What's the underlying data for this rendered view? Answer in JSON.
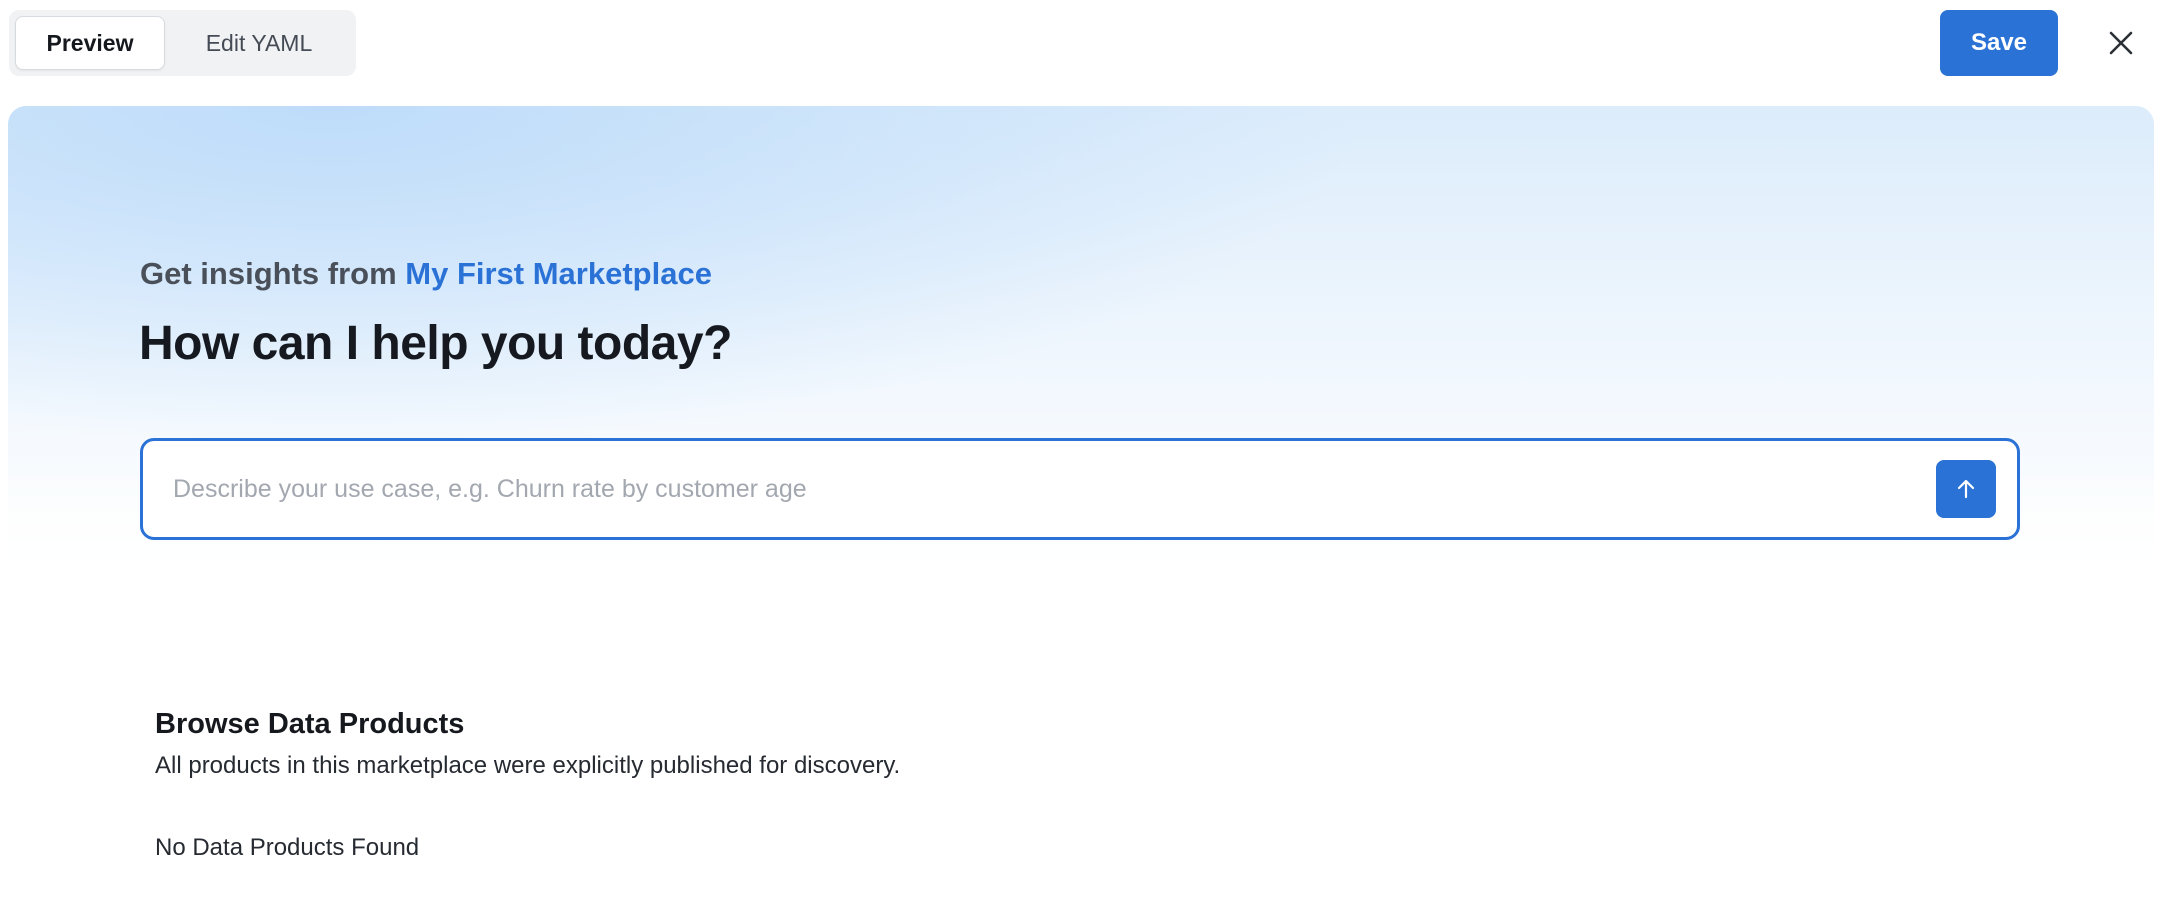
{
  "toolbar": {
    "tabs": [
      {
        "label": "Preview",
        "active": true
      },
      {
        "label": "Edit YAML",
        "active": false
      }
    ],
    "save_label": "Save",
    "close_icon": "close-icon"
  },
  "hero": {
    "subtitle_prefix": "Get insights from",
    "marketplace_name": "My First Marketplace",
    "heading": "How can I help you today?",
    "search": {
      "placeholder": "Describe your use case, e.g. Churn rate by customer age",
      "value": "",
      "submit_icon": "arrow-up-icon"
    }
  },
  "browse": {
    "title": "Browse Data Products",
    "description": "All products in this marketplace were explicitly published for discovery.",
    "empty_text": "No Data Products Found"
  },
  "colors": {
    "accent": "#2b72d6",
    "heading": "#161a20",
    "placeholder": "#a3a8b0"
  }
}
